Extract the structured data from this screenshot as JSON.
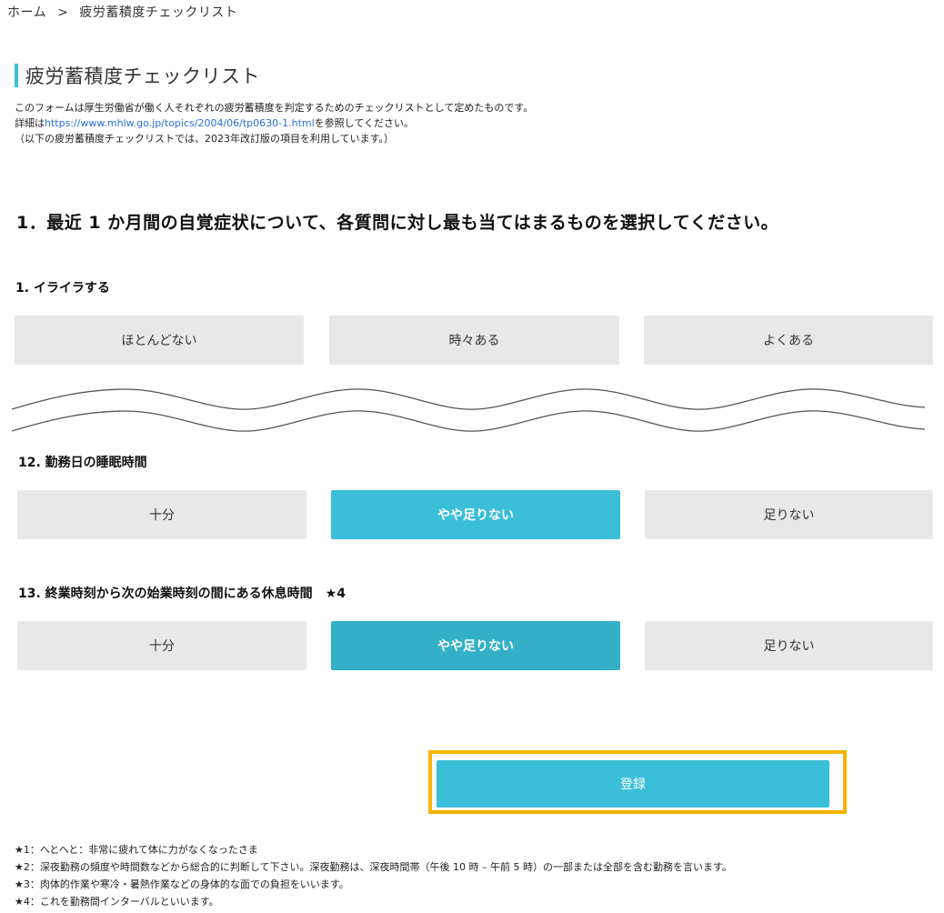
{
  "breadcrumb": {
    "home": "ホーム",
    "separator": ">",
    "current": "疲労蓄積度チェックリスト"
  },
  "page_title": "疲労蓄積度チェックリスト",
  "intro": {
    "line1": "このフォームは厚生労働省が働く人それぞれの疲労蓄積度を判定するためのチェックリストとして定めたものです。",
    "line2_prefix": "詳細は",
    "line2_link": "https://www.mhlw.go.jp/topics/2004/06/tp0630-1.html",
    "line2_suffix": "を参照してください。",
    "line3": "（以下の疲労蓄積度チェックリストでは、2023年改訂版の項目を利用しています。）"
  },
  "section_heading": "1．最近 1 か月間の自覚症状について、各質問に対し最も当てはまるものを選択してください。",
  "questions": [
    {
      "label": "1. イライラする",
      "options": [
        "ほとんどない",
        "時々ある",
        "よくある"
      ],
      "selected": ""
    },
    {
      "label": "12. 勤務日の睡眠時間",
      "options": [
        "十分",
        "やや足りない",
        "足りない"
      ],
      "selected": "やや足りない"
    },
    {
      "label": "13. 終業時刻から次の始業時刻の間にある休息時間　★4",
      "options": [
        "十分",
        "やや足りない",
        "足りない"
      ],
      "selected": "やや足りない"
    }
  ],
  "submit_label": "登録",
  "footnotes": [
    "★1：へとへと：非常に疲れて体に力がなくなったさま",
    "★2：深夜勤務の頻度や時間数などから総合的に判断して下さい。深夜勤務は、深夜時間帯（午後 10 時 – 午前 5 時）の一部または全部を含む勤務を言います。",
    "★3：肉体的作業や寒冷・暑熱作業などの身体的な面での負担をいいます。",
    "★4：これを勤務間インターバルといいます。"
  ],
  "colors": {
    "accent": "#3bbfd9",
    "accent_hover": "#33b0c8",
    "option_bg": "#e8e8e8",
    "highlight_frame": "#f5b400",
    "link": "#2a6fd6"
  }
}
